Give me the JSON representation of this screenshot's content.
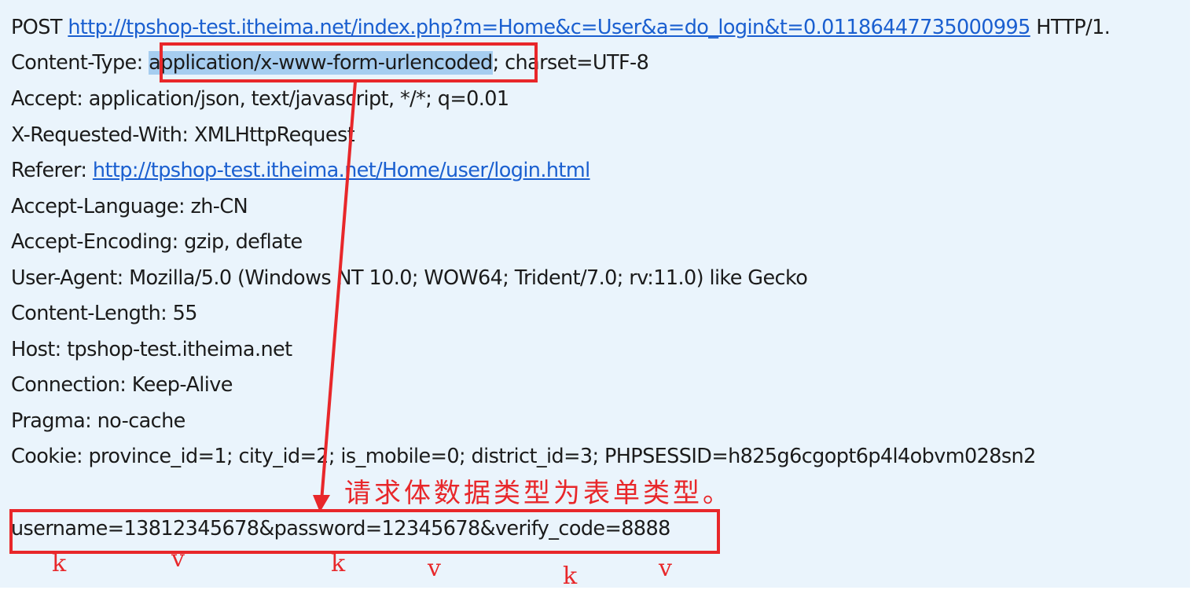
{
  "request": {
    "request_line": {
      "method": "POST",
      "url": "http://tpshop-test.itheima.net/index.php?m=Home&c=User&a=do_login&t=0.01186447735000995",
      "protocol": "HTTP/1."
    },
    "content_type": {
      "label": "Content-Type:",
      "value_highlighted": "application/x-www-form-urlencoded",
      "value_rest": "; charset=UTF-8"
    },
    "headers": [
      "Accept: application/json, text/javascript, */*; q=0.01",
      "X-Requested-With: XMLHttpRequest"
    ],
    "referer": {
      "label": "Referer:",
      "url": "http://tpshop-test.itheima.net/Home/user/login.html"
    },
    "headers_after": [
      "Accept-Language: zh-CN",
      "Accept-Encoding: gzip, deflate",
      "User-Agent: Mozilla/5.0 (Windows NT 10.0; WOW64; Trident/7.0; rv:11.0) like Gecko",
      "Content-Length: 55",
      "Host: tpshop-test.itheima.net",
      "Connection: Keep-Alive",
      "Pragma: no-cache",
      "Cookie: province_id=1; city_id=2; is_mobile=0; district_id=3; PHPSESSID=h825g6cgopt6p4l4obvm028sn2"
    ],
    "body": "username=13812345678&password=12345678&verify_code=8888"
  },
  "annotation": {
    "note": "请求体数据类型为表单类型。",
    "marks": [
      "k",
      "v",
      "k",
      "v",
      "k",
      "v"
    ],
    "color": "#e8272a"
  }
}
